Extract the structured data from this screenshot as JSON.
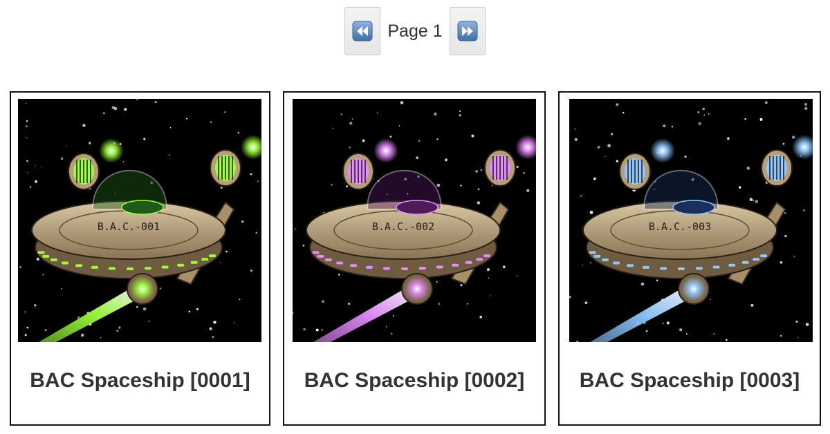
{
  "pagination": {
    "prev_icon": "rewind-icon",
    "label": "Page 1",
    "next_icon": "fast-forward-icon"
  },
  "cards": [
    {
      "title": "BAC Spaceship [0001]",
      "hull_text": "B.A.C.-001",
      "glow_color": "#9cff3a",
      "dome_color": "#1f5a1a"
    },
    {
      "title": "BAC Spaceship [0002]",
      "hull_text": "B.A.C.-002",
      "glow_color": "#e58cff",
      "dome_color": "#4d1a5a"
    },
    {
      "title": "BAC Spaceship [0003]",
      "hull_text": "B.A.C.-003",
      "glow_color": "#8fc7ff",
      "dome_color": "#1a2f5a"
    }
  ]
}
